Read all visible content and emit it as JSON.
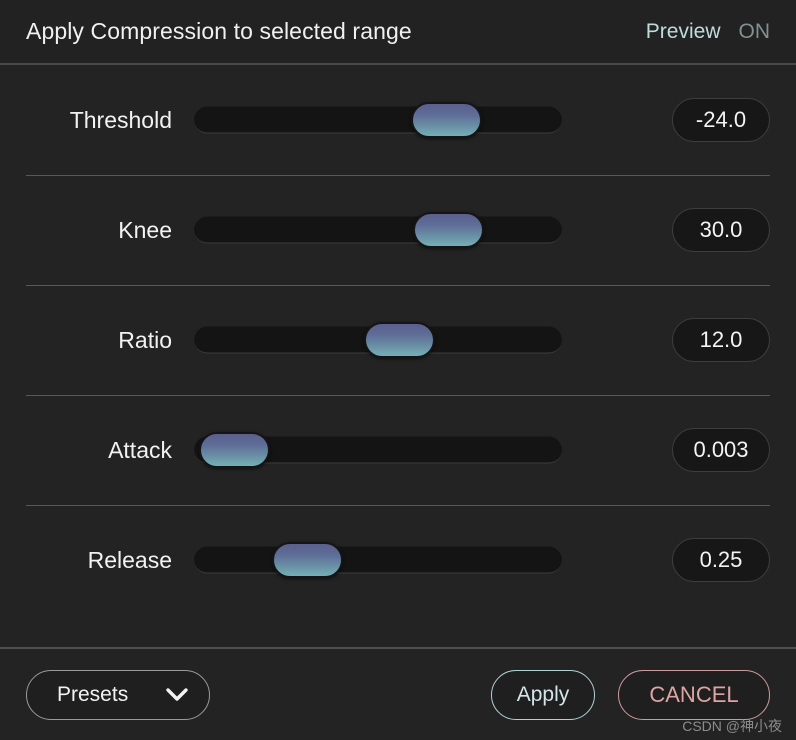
{
  "header": {
    "title": "Apply Compression to selected range",
    "preview_label": "Preview",
    "preview_state": "ON"
  },
  "sliders": [
    {
      "label": "Threshold",
      "value": "-24.0",
      "thumb_pct": 68.5
    },
    {
      "label": "Knee",
      "value": "30.0",
      "thumb_pct": 69.0
    },
    {
      "label": "Ratio",
      "value": "12.0",
      "thumb_pct": 55.7
    },
    {
      "label": "Attack",
      "value": "0.003",
      "thumb_pct": 10.9
    },
    {
      "label": "Release",
      "value": "0.25",
      "thumb_pct": 30.7
    }
  ],
  "footer": {
    "presets_label": "Presets",
    "apply_label": "Apply",
    "cancel_label": "CANCEL"
  },
  "watermark": "CSDN @神小夜",
  "colors": {
    "background": "#232323",
    "thumb_top": "#5b5f8e",
    "thumb_bottom": "#74b0b6",
    "preview_accent": "#bfdcdd",
    "apply_accent": "#d3e6e8",
    "cancel_accent": "#dda4a4",
    "divider": "#585858"
  }
}
